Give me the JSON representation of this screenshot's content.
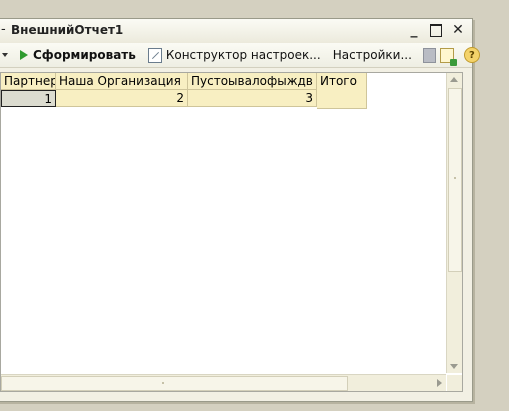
{
  "window": {
    "title": "ВнешнийОтчет1",
    "left_glyph": "-",
    "minimize_glyph": "_",
    "close_glyph": "✕"
  },
  "toolbar": {
    "menu_label": "",
    "generate_label": "Сформировать",
    "constructor_label": "Конструктор настроек...",
    "settings_label": "Настройки...",
    "help_label": "?"
  },
  "table": {
    "columns": [
      "Партнер",
      "Наша Организация",
      "Пустоывалофыждв",
      "Итого"
    ],
    "rows": [
      {
        "values": [
          "1",
          "2",
          "3",
          ""
        ]
      }
    ]
  }
}
